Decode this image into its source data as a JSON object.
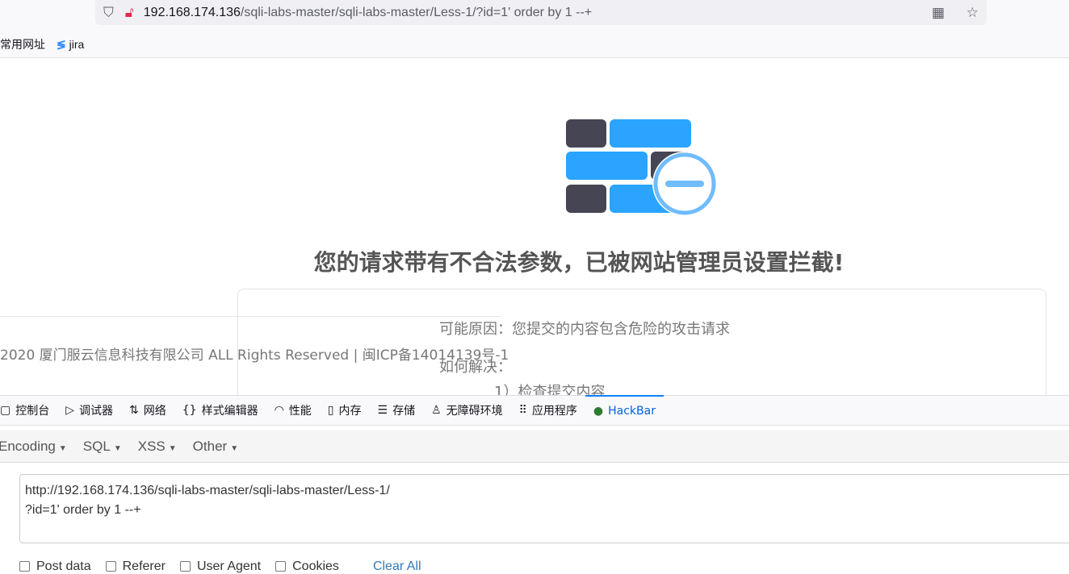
{
  "browser": {
    "url_host": "192.168.174.136",
    "url_path": "/sqli-labs-master/sqli-labs-master/Less-1/?id=1' order by 1 --+",
    "bookmarks": [
      "常用网址",
      "jira"
    ]
  },
  "page": {
    "title": "您的请求带有不合法参数，已被网站管理员设置拦截!",
    "reason": "可能原因：您提交的内容包含危险的攻击请求",
    "solve": "如何解决：",
    "solve_item": "1）检查提交内容",
    "footer": "2020 厦门服云信息科技有限公司 ALL Rights Reserved | 闽ICP备14014139号-1"
  },
  "devtools": {
    "tabs": [
      {
        "icon": "console-icon",
        "glyph": "▢",
        "label": "控制台"
      },
      {
        "icon": "debugger-icon",
        "glyph": "▷",
        "label": "调试器"
      },
      {
        "icon": "network-icon",
        "glyph": "⇅",
        "label": "网络"
      },
      {
        "icon": "style-editor-icon",
        "glyph": "{}",
        "label": "样式编辑器"
      },
      {
        "icon": "performance-icon",
        "glyph": "◠",
        "label": "性能"
      },
      {
        "icon": "memory-icon",
        "glyph": "▯",
        "label": "内存"
      },
      {
        "icon": "storage-icon",
        "glyph": "☰",
        "label": "存储"
      },
      {
        "icon": "accessibility-icon",
        "glyph": "♙",
        "label": "无障碍环境"
      },
      {
        "icon": "application-icon",
        "glyph": "⠿",
        "label": "应用程序"
      },
      {
        "icon": "hackbar-icon",
        "glyph": "●",
        "label": "HackBar"
      }
    ],
    "active_tab": "HackBar"
  },
  "hackbar": {
    "menus": [
      "Encoding",
      "SQL",
      "XSS",
      "Other"
    ],
    "url_value": "http://192.168.174.136/sqli-labs-master/sqli-labs-master/Less-1/\n?id=1' order by 1 --+",
    "options": [
      "Post data",
      "Referer",
      "User Agent",
      "Cookies"
    ],
    "clear_all": "Clear All"
  },
  "colors": {
    "accent": "#0a84ff",
    "shield_blue": "#2aa4ff",
    "brick_dark": "#454553"
  }
}
